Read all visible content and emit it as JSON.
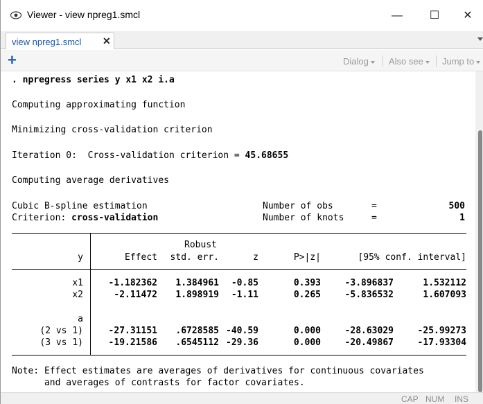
{
  "window": {
    "title": "Viewer - view npreg1.smcl",
    "icon": "eye-icon",
    "controls": {
      "minimize": "—",
      "maximize": "☐",
      "close": "✕"
    }
  },
  "tab": {
    "label": "view npreg1.smcl",
    "close": "✕"
  },
  "toolbar": {
    "add": "+",
    "dialog": "Dialog",
    "also_see": "Also see",
    "jump_to": "Jump to"
  },
  "output": {
    "command": ". npregress series y x1 x2 i.a",
    "line1": "Computing approximating function",
    "line2": "Minimizing cross-validation criterion",
    "iteration_label": "Iteration 0:  Cross-validation criterion = ",
    "iteration_value": "45.68655",
    "line4": "Computing average derivatives",
    "est_label": "Cubic B-spline estimation",
    "criterion_label": "Criterion: ",
    "criterion_value": "cross-validation",
    "nobs_label": "Number of obs",
    "nobs_value": "500",
    "nknots_label": "Number of knots",
    "nknots_value": "1",
    "eq": "="
  },
  "table": {
    "header": {
      "y": "y",
      "effect": "Effect",
      "robust": "Robust",
      "stderr": "std. err.",
      "z": "z",
      "p": "P>|z|",
      "ci": "[95% conf. interval]"
    },
    "rows": [
      {
        "label": "x1",
        "effect": "-1.182362",
        "se": "1.384961",
        "z": "-0.85",
        "p": "0.393",
        "lo": "-3.896837",
        "hi": "1.532112"
      },
      {
        "label": "x2",
        "effect": "-2.11472",
        "se": "1.898919",
        "z": "-1.11",
        "p": "0.265",
        "lo": "-5.836532",
        "hi": "1.607093"
      }
    ],
    "factor": "a",
    "factor_rows": [
      {
        "label": "(2 vs 1)",
        "effect": "-27.31151",
        "se": ".6728585",
        "z": "-40.59",
        "p": "0.000",
        "lo": "-28.63029",
        "hi": "-25.99273"
      },
      {
        "label": "(3 vs 1)",
        "effect": "-19.21586",
        "se": ".6545112",
        "z": "-29.36",
        "p": "0.000",
        "lo": "-20.49867",
        "hi": "-17.93304"
      }
    ]
  },
  "note": {
    "line1": "Note: Effect estimates are averages of derivatives for continuous covariates",
    "line2": "      and averages of contrasts for factor covariates."
  },
  "status": {
    "cap": "CAP",
    "num": "NUM",
    "ins": "INS"
  }
}
